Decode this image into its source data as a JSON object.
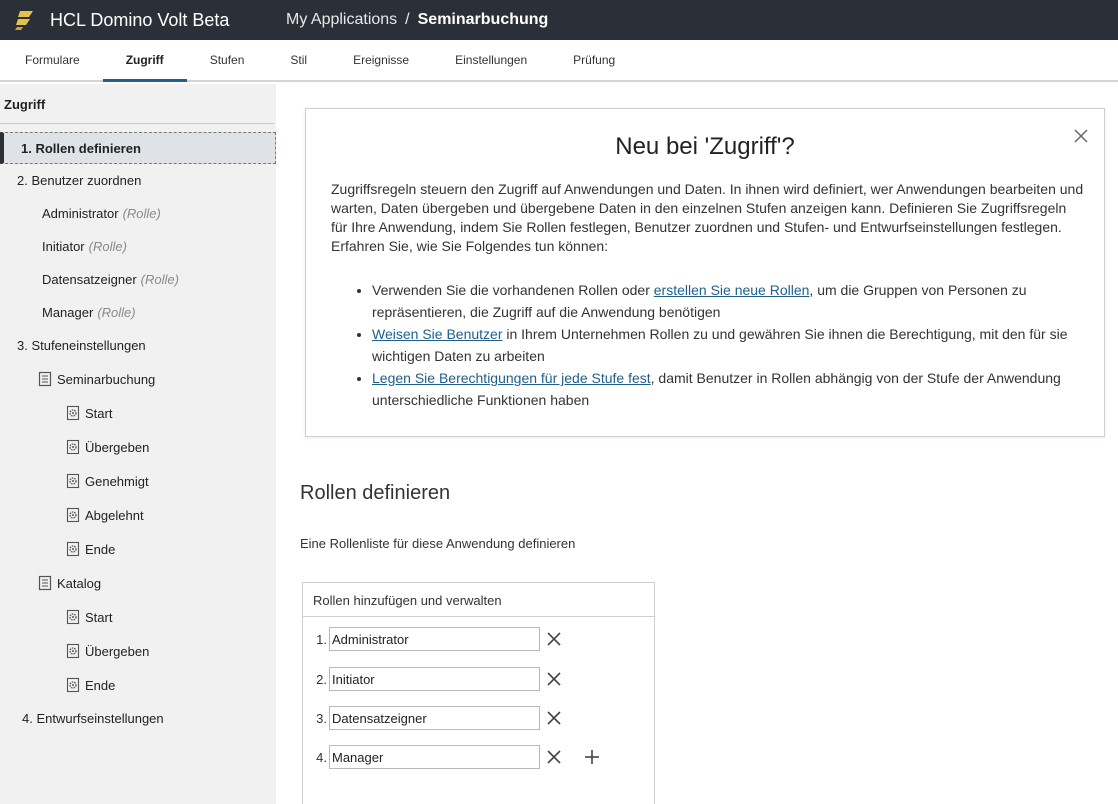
{
  "header": {
    "app_title": "HCL Domino Volt Beta",
    "breadcrumb_link": "My Applications",
    "breadcrumb_sep": "/",
    "breadcrumb_current": "Seminarbuchung"
  },
  "tabs": [
    {
      "label": "Formulare"
    },
    {
      "label": "Zugriff"
    },
    {
      "label": "Stufen"
    },
    {
      "label": "Stil"
    },
    {
      "label": "Ereignisse"
    },
    {
      "label": "Einstellungen"
    },
    {
      "label": "Prüfung"
    }
  ],
  "sidebar": {
    "title": "Zugriff",
    "items": {
      "rollen": "1. Rollen definieren",
      "benutzer": "2. Benutzer zuordnen",
      "administrator": "Administrator",
      "initiator": "Initiator",
      "datensatzeigner": "Datensatzeigner",
      "manager": "Manager",
      "role_tag": "(Rolle)",
      "stufen": "3. Stufeneinstellungen",
      "seminarbuchung": "Seminarbuchung",
      "start": "Start",
      "uebergeben": "Übergeben",
      "genehmigt": "Genehmigt",
      "abgelehnt": "Abgelehnt",
      "ende": "Ende",
      "katalog": "Katalog",
      "entwurf": "4. Entwurfseinstellungen"
    }
  },
  "info": {
    "title": "Neu bei 'Zugriff'?",
    "intro": "Zugriffsregeln steuern den Zugriff auf Anwendungen und Daten. In ihnen wird definiert, wer Anwendungen bearbeiten und warten, Daten übergeben und übergebene Daten in den einzelnen Stufen anzeigen kann. Definieren Sie Zugriffsregeln für Ihre Anwendung, indem Sie Rollen festlegen, Benutzer zuordnen und Stufen- und Entwurfseinstellungen festlegen. Erfahren Sie, wie Sie Folgendes tun können:",
    "b1_pre": "Verwenden Sie die vorhandenen Rollen oder ",
    "b1_link": "erstellen Sie neue Rollen",
    "b1_post": ", um die Gruppen von Personen zu repräsentieren, die Zugriff auf die Anwendung benötigen",
    "b2_link": "Weisen Sie Benutzer",
    "b2_post": " in Ihrem Unternehmen Rollen zu und gewähren Sie ihnen die Berechtigung, mit den für sie wichtigen Daten zu arbeiten",
    "b3_link": "Legen Sie Berechtigungen für jede Stufe fest",
    "b3_post": ", damit Benutzer in Rollen abhängig von der Stufe der Anwendung unterschiedliche Funktionen haben"
  },
  "section": {
    "title": "Rollen definieren",
    "description": "Eine Rollenliste für diese Anwendung definieren",
    "box_header": "Rollen hinzufügen und verwalten",
    "roles": [
      {
        "num": "1.",
        "value": "Administrator"
      },
      {
        "num": "2.",
        "value": "Initiator"
      },
      {
        "num": "3.",
        "value": "Datensatzeigner"
      },
      {
        "num": "4.",
        "value": "Manager"
      }
    ]
  },
  "colors": {
    "topbar": "#2b3038",
    "link": "#1f5f8c",
    "sidebar_bg": "#f1f1f1",
    "logo": "#e2c24a"
  },
  "icons": {
    "logo": "volt-logo-icon",
    "close": "close-icon",
    "form": "form-icon",
    "stage": "gear-icon",
    "delete": "close-icon",
    "add": "plus-icon"
  }
}
